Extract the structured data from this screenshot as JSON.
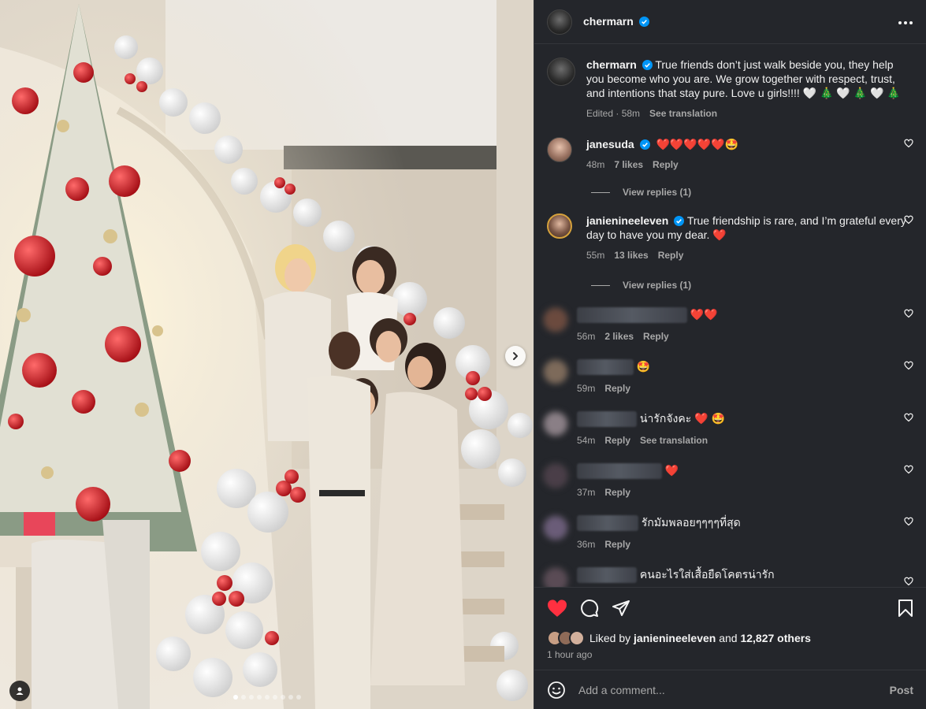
{
  "post": {
    "author": "chermarn",
    "caption": "True friends don’t just walk beside you, they help you become who you are. We grow together with respect, trust, and intentions that stay pure. Love u girls!!!! 🤍 🎄 🤍 🎄 🤍 🎄",
    "caption_meta_time": "Edited · 58m",
    "see_translation": "See translation",
    "carousel_total": 9,
    "carousel_active": 1
  },
  "comments": [
    {
      "user": "janesuda",
      "verified": true,
      "text": "",
      "emojis": "❤️❤️❤️❤️❤️🤩",
      "time": "48m",
      "likes": "7 likes",
      "reply": "Reply",
      "replies": "View replies (1)"
    },
    {
      "user": "janienineeleven",
      "verified": true,
      "text": "True friendship is rare, and I’m grateful every day to have you my dear. ❤️",
      "time": "55m",
      "likes": "13 likes",
      "reply": "Reply",
      "replies": "View replies (1)"
    },
    {
      "user": "",
      "text": "❤️❤️",
      "time": "56m",
      "likes": "2 likes",
      "reply": "Reply"
    },
    {
      "user": "",
      "text": "🤩",
      "time": "59m",
      "reply": "Reply"
    },
    {
      "user": "",
      "text": "น่ารักจังคะ ❤️ 🤩",
      "time": "54m",
      "reply": "Reply",
      "translate": "See translation"
    },
    {
      "user": "",
      "text": "❤️",
      "time": "37m",
      "reply": "Reply"
    },
    {
      "user": "",
      "text": "รักมัมพลอยๆๆๆๆที่สุด",
      "time": "36m",
      "reply": "Reply"
    },
    {
      "user": "",
      "text": "คนอะไรใส่เสื้อยืดโคตรน่ารัก"
    }
  ],
  "actions": {
    "liked_prefix": "Liked by",
    "liked_user": "janienineeleven",
    "liked_and": "and",
    "liked_others": "12,827 others",
    "posted_time": "1 hour ago"
  },
  "composer": {
    "placeholder": "Add a comment...",
    "post_label": "Post"
  },
  "icons": {
    "more": "more-icon",
    "verified": "verified-badge-icon",
    "like": "heart-icon",
    "comment": "comment-icon",
    "share": "share-icon",
    "save": "bookmark-icon",
    "emoji": "emoji-icon",
    "next": "chevron-right-icon",
    "tag": "user-tag-icon"
  },
  "colors": {
    "panel": "#24262b",
    "accent_heart": "#ff3040",
    "verified": "#0095f6"
  }
}
